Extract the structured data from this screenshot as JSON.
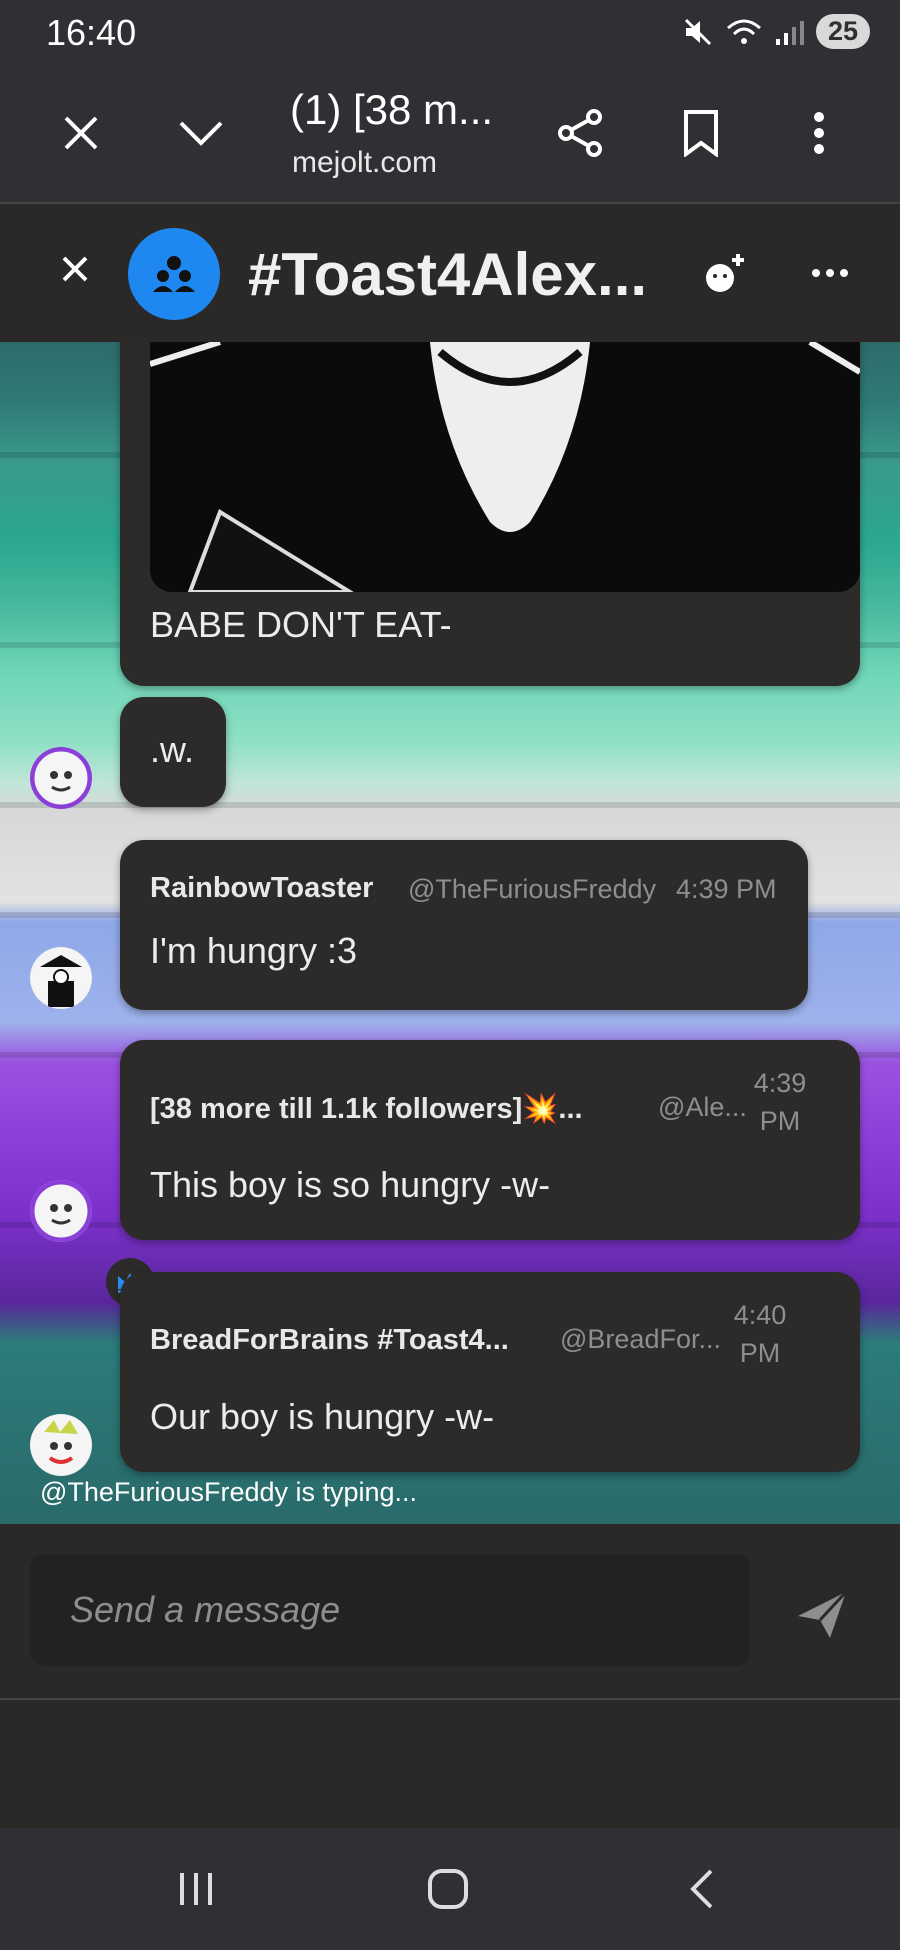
{
  "status_bar": {
    "time": "16:40",
    "battery": "25"
  },
  "browser": {
    "title": "(1) [38 m...",
    "url": "mejolt.com"
  },
  "chat_header": {
    "title": "#Toast4Alex..."
  },
  "messages": [
    {
      "text": "BABE DON'T EAT-"
    },
    {
      "text": ".w."
    },
    {
      "name": "RainbowToaster",
      "handle": "@TheFuriousFreddy",
      "time": "4:39 PM",
      "text": "I'm hungry :3"
    },
    {
      "name": "[38 more till 1.1k followers]💥...",
      "handle": "@Ale...",
      "time_line1": "4:39",
      "time_line2": "PM",
      "text": "This boy is so hungry -w-"
    },
    {
      "name": "BreadForBrains #Toast4...",
      "handle": "@BreadFor...",
      "time_line1": "4:40",
      "time_line2": "PM",
      "text": "Our boy is hungry -w-"
    }
  ],
  "typing_indicator": "@TheFuriousFreddy is typing...",
  "composer": {
    "placeholder": "Send a message"
  },
  "colors": {
    "accent_blue": "#1f87f0",
    "bubble_bg": "#2c2b29",
    "header_bg": "#2a2927"
  }
}
